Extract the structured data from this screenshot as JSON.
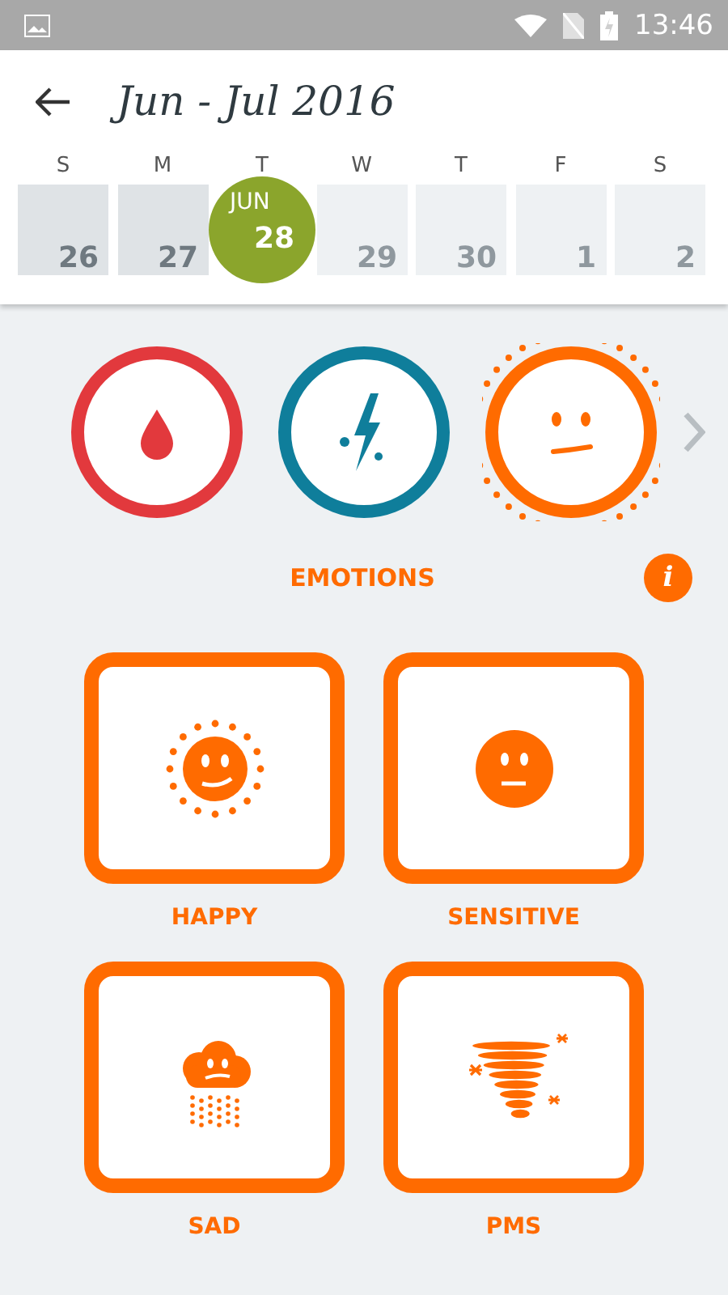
{
  "status_bar": {
    "time": "13:46"
  },
  "header": {
    "title": "Jun - Jul 2016"
  },
  "days": [
    {
      "weekday": "S",
      "day": "26",
      "past": true,
      "selected": false
    },
    {
      "weekday": "M",
      "day": "27",
      "past": true,
      "selected": false
    },
    {
      "weekday": "T",
      "day": "28",
      "month": "JUN",
      "selected": true
    },
    {
      "weekday": "W",
      "day": "29",
      "past": false,
      "selected": false
    },
    {
      "weekday": "T",
      "day": "30",
      "past": false,
      "selected": false
    },
    {
      "weekday": "F",
      "day": "1",
      "past": false,
      "selected": false
    },
    {
      "weekday": "S",
      "day": "2",
      "past": false,
      "selected": false
    }
  ],
  "categories": [
    {
      "kind": "bleeding",
      "color": "#e2393d",
      "selected": false
    },
    {
      "kind": "energy",
      "color": "#0f7e9b",
      "selected": false
    },
    {
      "kind": "emotions",
      "color": "#ff6b00",
      "selected": true
    }
  ],
  "section": {
    "title": "EMOTIONS",
    "info": "i"
  },
  "options": [
    {
      "kind": "happy",
      "label": "HAPPY",
      "selected": false
    },
    {
      "kind": "sensitive",
      "label": "SENSITIVE",
      "selected": false
    },
    {
      "kind": "sad",
      "label": "SAD",
      "selected": false
    },
    {
      "kind": "pms",
      "label": "PMS",
      "selected": false
    }
  ]
}
